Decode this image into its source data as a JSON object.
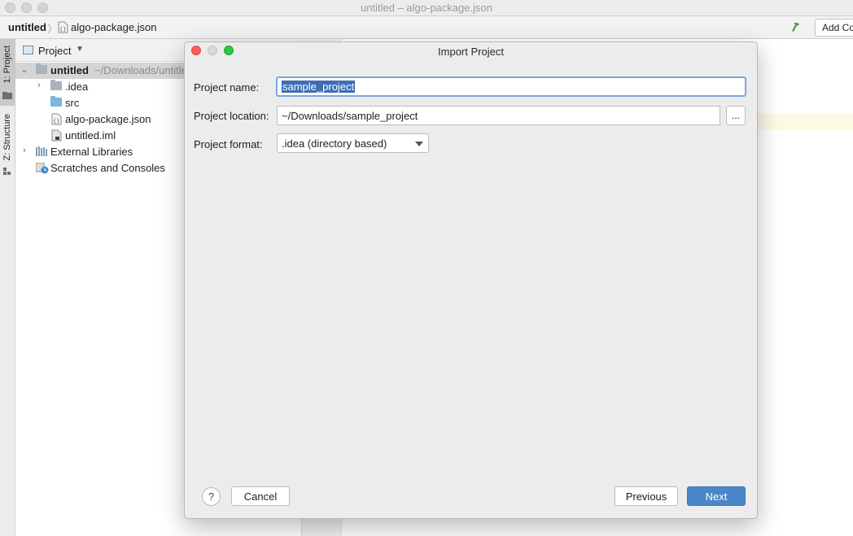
{
  "window": {
    "title": "untitled – algo-package.json"
  },
  "navbar": {
    "root": "untitled",
    "separator": "〉",
    "file": "algo-package.json",
    "add_configuration": "Add Configuration..."
  },
  "toolstrip": {
    "project_tab": "1: Project",
    "structure_tab": "Z: Structure"
  },
  "project_panel": {
    "title": "Project",
    "tree": {
      "root_name": "untitled",
      "root_path": "~/Downloads/untitled",
      "idea": ".idea",
      "src": "src",
      "algo": "algo-package.json",
      "iml": "untitled.iml",
      "external": "External Libraries",
      "scratches": "Scratches and Consoles"
    }
  },
  "dialog": {
    "title": "Import Project",
    "name_label": "Project name:",
    "name_value": "sample_project",
    "location_label": "Project location:",
    "location_value": "~/Downloads/sample_project",
    "browse_label": "...",
    "format_label": "Project format:",
    "format_value": ".idea (directory based)",
    "help_label": "?",
    "cancel_label": "Cancel",
    "previous_label": "Previous",
    "next_label": "Next"
  },
  "colors": {
    "accent": "#4a86c8",
    "selection": "#3e6eb5",
    "close": "#fc5f57",
    "minimize": "#d8d8d8",
    "zoom": "#2ac840",
    "hammer": "#4e9a50"
  }
}
